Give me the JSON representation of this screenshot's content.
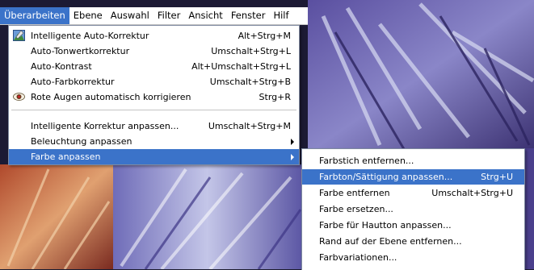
{
  "menubar": {
    "items": [
      {
        "label": "Überarbeiten",
        "active": true
      },
      {
        "label": "Ebene"
      },
      {
        "label": "Auswahl"
      },
      {
        "label": "Filter"
      },
      {
        "label": "Ansicht"
      },
      {
        "label": "Fenster"
      },
      {
        "label": "Hilf"
      }
    ]
  },
  "menu": {
    "items": [
      {
        "label": "Intelligente Auto-Korrektur",
        "shortcut": "Alt+Strg+M",
        "icon": "auto-correct-icon"
      },
      {
        "label": "Auto-Tonwertkorrektur",
        "shortcut": "Umschalt+Strg+L"
      },
      {
        "label": "Auto-Kontrast",
        "shortcut": "Alt+Umschalt+Strg+L"
      },
      {
        "label": "Auto-Farbkorrektur",
        "shortcut": "Umschalt+Strg+B"
      },
      {
        "label": "Rote Augen automatisch korrigieren",
        "shortcut": "Strg+R",
        "icon": "red-eye-icon"
      },
      {
        "label": "Intelligente Korrektur anpassen...",
        "shortcut": "Umschalt+Strg+M"
      },
      {
        "label": "Beleuchtung anpassen",
        "submenu": true
      },
      {
        "label": "Farbe anpassen",
        "submenu": true,
        "highlighted": true
      }
    ]
  },
  "submenu": {
    "items": [
      {
        "label": "Farbstich entfernen...",
        "shortcut": ""
      },
      {
        "label": "Farbton/Sättigung anpassen...",
        "shortcut": "Strg+U",
        "highlighted": true
      },
      {
        "label": "Farbe entfernen",
        "shortcut": "Umschalt+Strg+U"
      },
      {
        "label": "Farbe ersetzen...",
        "shortcut": ""
      },
      {
        "label": "Farbe für Hautton anpassen...",
        "shortcut": ""
      },
      {
        "label": "Rand auf der Ebene entfernen...",
        "shortcut": ""
      },
      {
        "label": "Farbvariationen...",
        "shortcut": ""
      }
    ]
  },
  "colors": {
    "highlight": "#3b73c9",
    "menu_bg": "#ffffff"
  }
}
